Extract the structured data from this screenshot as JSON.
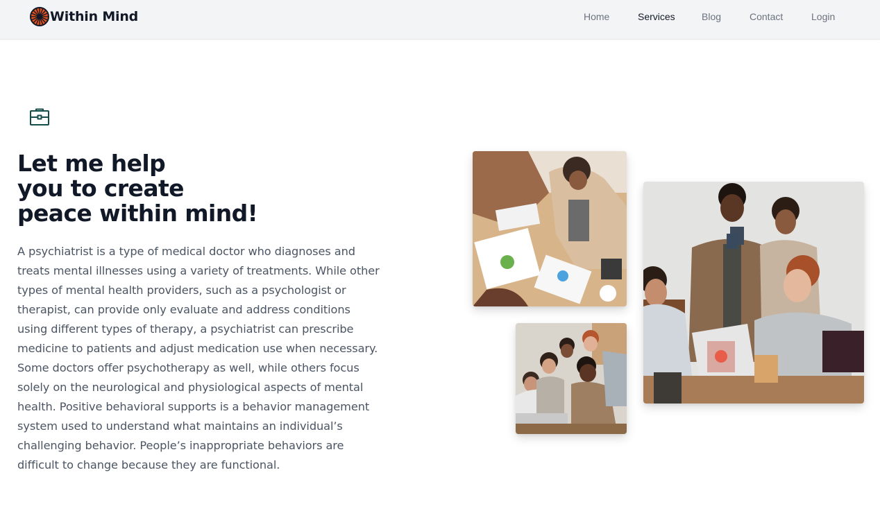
{
  "brand": {
    "name": "Within Mind",
    "logo_icon": "flower-logo-icon",
    "logo_colors": [
      "#e2531d",
      "#111827"
    ]
  },
  "nav": {
    "items": [
      {
        "label": "Home",
        "active": false
      },
      {
        "label": "Services",
        "active": true
      },
      {
        "label": "Blog",
        "active": false
      },
      {
        "label": "Contact",
        "active": false
      },
      {
        "label": "Login",
        "active": false
      }
    ]
  },
  "hero": {
    "icon": "briefcase-icon",
    "icon_color": "#134e4a",
    "title_lines": [
      "Let me help",
      "you to create",
      "peace within mind!"
    ],
    "body": "A psychiatrist is a type of medical doctor who diagnoses and treats mental illnesses using a variety of treatments. While other types of mental health providers, such as a psychologist or therapist, can provide only evaluate and address conditions using different types of therapy, a psychiatrist can prescribe medicine to patients and adjust medication use when necessary. Some doctors offer psychotherapy as well, while others focus solely on the neurological and physiological aspects of mental health. Positive behavioral supports is a behavior management system used to understand what maintains an individual’s challenging behavior. People’s inappropriate behaviors are difficult to change because they are functional."
  },
  "gallery": {
    "images": [
      {
        "name": "team-meeting-photo"
      },
      {
        "name": "group-laptop-photo"
      },
      {
        "name": "office-colleagues-photo"
      }
    ]
  },
  "colors": {
    "header_bg": "#f3f4f6",
    "text_dark": "#111827",
    "text_muted": "#4b5563",
    "nav_link": "#6b7280"
  }
}
